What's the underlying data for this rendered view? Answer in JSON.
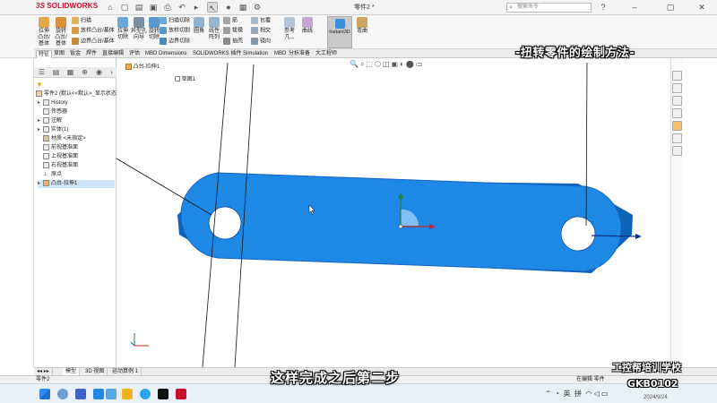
{
  "app": {
    "logo": "SOLIDWORKS",
    "doc_title": "零件2 *",
    "search_placeholder": "搜索命令"
  },
  "ribbon": {
    "extrude_boss": "拉伸\n凸台/\n基体",
    "revolve_boss": "旋转\n凸台/\n基体",
    "sweep": "扫描",
    "loft_boss": "放样凸台/基体",
    "boundary_boss": "边界凸台/基体",
    "extrude_cut": "拉伸\n切除",
    "hole_wizard": "异型孔\n向导",
    "revolve_cut": "旋转\n切除",
    "swept_cut": "扫描切除",
    "lofted_cut": "放样切割",
    "boundary_cut": "边界切除",
    "fillet": "圆角",
    "linear_pattern": "线性\n阵列",
    "rib": "筋",
    "draft": "拔模",
    "shell": "抽壳",
    "wrap": "包覆",
    "intersect": "相交",
    "mirror": "镜向",
    "ref_geometry": "参考\n几...",
    "curves": "曲线",
    "instant3d": "Instant3D",
    "bend": "弯曲"
  },
  "tabs": [
    "特征",
    "草图",
    "钣金",
    "焊件",
    "直接编辑",
    "评估",
    "MBD Dimensions",
    "SOLIDWORKS 插件",
    "Simulation",
    "MBD",
    "分析准备",
    "大工程师"
  ],
  "active_tab": 0,
  "feature_tree": {
    "root": "零件2 (默认<<默认>_显示状态",
    "items": [
      {
        "label": "History",
        "arrow": "▸"
      },
      {
        "label": "传感器",
        "arrow": ""
      },
      {
        "label": "注解",
        "arrow": "▸"
      },
      {
        "label": "实体(1)",
        "arrow": "▸"
      },
      {
        "label": "材质 <未指定>",
        "arrow": ""
      },
      {
        "label": "前视基准面",
        "arrow": ""
      },
      {
        "label": "上视基准面",
        "arrow": ""
      },
      {
        "label": "右视基准面",
        "arrow": ""
      },
      {
        "label": "原点",
        "arrow": ""
      },
      {
        "label": "凸台-拉伸1",
        "arrow": "▸"
      }
    ],
    "selected_index": 9
  },
  "graphics": {
    "breadcrumb": "凸台-拉伸1",
    "breadcrumb_child": "草图1",
    "part_color": "#1e88e5",
    "part_edge": "#1565c0"
  },
  "overlay": {
    "banner": "-扭转零件的绘制方法-",
    "subtitle": "这样完成之后第二步",
    "watermark_line1": "工控帮培训学校",
    "watermark_line2": "GKB0102"
  },
  "bottom_tabs": [
    "模型",
    "3D 视图",
    "运动算例 1"
  ],
  "status": {
    "left": "零件2",
    "edit": "在编辑 零件"
  },
  "taskbar": {
    "ime1": "英",
    "ime2": "拼",
    "date": "2024/9/24"
  }
}
